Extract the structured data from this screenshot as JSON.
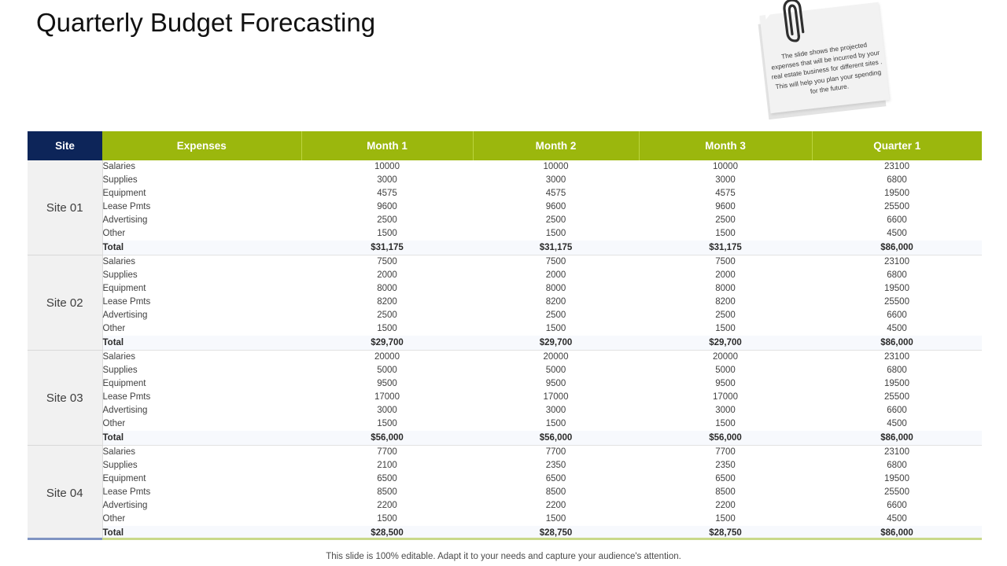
{
  "slide": {
    "title": "Quarterly Budget Forecasting",
    "footer": "This slide is 100% editable. Adapt it to your needs and capture your audience's attention."
  },
  "sticky_note": {
    "icon": "paperclip-icon",
    "text": "The slide shows the projected expenses that will be incurred by your real estate business for different sites . This will help you plan your spending for the future."
  },
  "colors": {
    "header_site": "#0d2559",
    "header_green": "#9bb70d",
    "site_cell_bg": "#f1f1f1",
    "total_row_bg": "#f7f9fd",
    "rule_blue": "#8094c2",
    "rule_green": "#c9d98a"
  },
  "table": {
    "columns": [
      "Site",
      "Expenses",
      "Month 1",
      "Month 2",
      "Month 3",
      "Quarter 1"
    ],
    "total_label": "Total",
    "groups": [
      {
        "site": "Site 01",
        "rows": [
          {
            "expense": "Salaries",
            "month1": "10000",
            "month2": "10000",
            "month3": "10000",
            "quarter1": "23100"
          },
          {
            "expense": "Supplies",
            "month1": "3000",
            "month2": "3000",
            "month3": "3000",
            "quarter1": "6800"
          },
          {
            "expense": "Equipment",
            "month1": "4575",
            "month2": "4575",
            "month3": "4575",
            "quarter1": "19500"
          },
          {
            "expense": "Lease Pmts",
            "month1": "9600",
            "month2": "9600",
            "month3": "9600",
            "quarter1": "25500"
          },
          {
            "expense": "Advertising",
            "month1": "2500",
            "month2": "2500",
            "month3": "2500",
            "quarter1": "6600"
          },
          {
            "expense": "Other",
            "month1": "1500",
            "month2": "1500",
            "month3": "1500",
            "quarter1": "4500"
          }
        ],
        "total": {
          "expense": "Total",
          "month1": "$31,175",
          "month2": "$31,175",
          "month3": "$31,175",
          "quarter1": "$86,000"
        }
      },
      {
        "site": "Site 02",
        "rows": [
          {
            "expense": "Salaries",
            "month1": "7500",
            "month2": "7500",
            "month3": "7500",
            "quarter1": "23100"
          },
          {
            "expense": "Supplies",
            "month1": "2000",
            "month2": "2000",
            "month3": "2000",
            "quarter1": "6800"
          },
          {
            "expense": "Equipment",
            "month1": "8000",
            "month2": "8000",
            "month3": "8000",
            "quarter1": "19500"
          },
          {
            "expense": "Lease Pmts",
            "month1": "8200",
            "month2": "8200",
            "month3": "8200",
            "quarter1": "25500"
          },
          {
            "expense": "Advertising",
            "month1": "2500",
            "month2": "2500",
            "month3": "2500",
            "quarter1": "6600"
          },
          {
            "expense": "Other",
            "month1": "1500",
            "month2": "1500",
            "month3": "1500",
            "quarter1": "4500"
          }
        ],
        "total": {
          "expense": "Total",
          "month1": "$29,700",
          "month2": "$29,700",
          "month3": "$29,700",
          "quarter1": "$86,000"
        }
      },
      {
        "site": "Site 03",
        "rows": [
          {
            "expense": "Salaries",
            "month1": "20000",
            "month2": "20000",
            "month3": "20000",
            "quarter1": "23100"
          },
          {
            "expense": "Supplies",
            "month1": "5000",
            "month2": "5000",
            "month3": "5000",
            "quarter1": "6800"
          },
          {
            "expense": "Equipment",
            "month1": "9500",
            "month2": "9500",
            "month3": "9500",
            "quarter1": "19500"
          },
          {
            "expense": "Lease Pmts",
            "month1": "17000",
            "month2": "17000",
            "month3": "17000",
            "quarter1": "25500"
          },
          {
            "expense": "Advertising",
            "month1": "3000",
            "month2": "3000",
            "month3": "3000",
            "quarter1": "6600"
          },
          {
            "expense": "Other",
            "month1": "1500",
            "month2": "1500",
            "month3": "1500",
            "quarter1": "4500"
          }
        ],
        "total": {
          "expense": "Total",
          "month1": "$56,000",
          "month2": "$56,000",
          "month3": "$56,000",
          "quarter1": "$86,000"
        }
      },
      {
        "site": "Site 04",
        "rows": [
          {
            "expense": "Salaries",
            "month1": "7700",
            "month2": "7700",
            "month3": "7700",
            "quarter1": "23100"
          },
          {
            "expense": "Supplies",
            "month1": "2100",
            "month2": "2350",
            "month3": "2350",
            "quarter1": "6800"
          },
          {
            "expense": "Equipment",
            "month1": "6500",
            "month2": "6500",
            "month3": "6500",
            "quarter1": "19500"
          },
          {
            "expense": "Lease Pmts",
            "month1": "8500",
            "month2": "8500",
            "month3": "8500",
            "quarter1": "25500"
          },
          {
            "expense": "Advertising",
            "month1": "2200",
            "month2": "2200",
            "month3": "2200",
            "quarter1": "6600"
          },
          {
            "expense": "Other",
            "month1": "1500",
            "month2": "1500",
            "month3": "1500",
            "quarter1": "4500"
          }
        ],
        "total": {
          "expense": "Total",
          "month1": "$28,500",
          "month2": "$28,750",
          "month3": "$28,750",
          "quarter1": "$86,000"
        }
      }
    ]
  }
}
